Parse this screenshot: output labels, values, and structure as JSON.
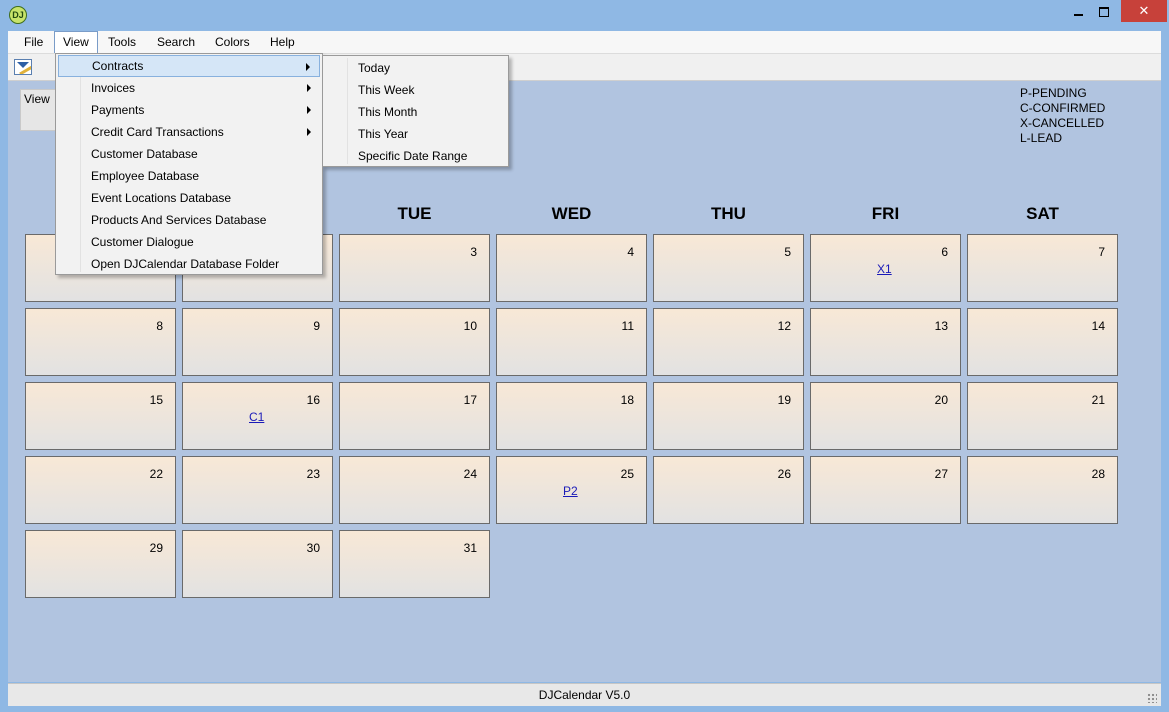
{
  "window": {
    "icon_text": "DJ",
    "close_glyph": "✕"
  },
  "menubar": [
    {
      "label": "File"
    },
    {
      "label": "View"
    },
    {
      "label": "Tools"
    },
    {
      "label": "Search"
    },
    {
      "label": "Colors"
    },
    {
      "label": "Help"
    }
  ],
  "view_panel": {
    "label": "View"
  },
  "legend": [
    "P-PENDING",
    "C-CONFIRMED",
    "X-CANCELLED",
    "L-LEAD"
  ],
  "weekday_headers": [
    "TUE",
    "WED",
    "THU",
    "FRI",
    "SAT"
  ],
  "calendar": {
    "day_cells": [
      {
        "day": ""
      },
      {
        "day": ""
      },
      {
        "day": "3"
      },
      {
        "day": "4"
      },
      {
        "day": "5"
      },
      {
        "day": "6",
        "event": "X1"
      },
      {
        "day": "7"
      },
      {
        "day": "8"
      },
      {
        "day": "9"
      },
      {
        "day": "10"
      },
      {
        "day": "11"
      },
      {
        "day": "12"
      },
      {
        "day": "13"
      },
      {
        "day": "14"
      },
      {
        "day": "15"
      },
      {
        "day": "16",
        "event": "C1"
      },
      {
        "day": "17"
      },
      {
        "day": "18"
      },
      {
        "day": "19"
      },
      {
        "day": "20"
      },
      {
        "day": "21"
      },
      {
        "day": "22"
      },
      {
        "day": "23"
      },
      {
        "day": "24"
      },
      {
        "day": "25",
        "event": "P2"
      },
      {
        "day": "26"
      },
      {
        "day": "27"
      },
      {
        "day": "28"
      },
      {
        "day": "29"
      },
      {
        "day": "30"
      },
      {
        "day": "31"
      }
    ]
  },
  "view_menu": {
    "items": [
      {
        "label": "Contracts",
        "submenu": true
      },
      {
        "label": "Invoices",
        "submenu": true
      },
      {
        "label": "Payments",
        "submenu": true
      },
      {
        "label": "Credit Card Transactions",
        "submenu": true
      },
      {
        "label": "Customer Database"
      },
      {
        "label": "Employee Database"
      },
      {
        "label": "Event Locations Database"
      },
      {
        "label": "Products And Services Database"
      },
      {
        "label": "Customer Dialogue"
      },
      {
        "label": "Open DJCalendar Database Folder"
      }
    ],
    "contracts_submenu": [
      {
        "label": "Today"
      },
      {
        "label": "This Week"
      },
      {
        "label": "This Month"
      },
      {
        "label": "This Year"
      },
      {
        "label": "Specific Date Range"
      }
    ]
  },
  "status_bar": {
    "text": "DJCalendar V5.0"
  },
  "colors": {
    "title_bar": "#8fb8e4",
    "content_bg": "#b1c4e0",
    "close_button": "#c7413a",
    "event_link": "#1a1ab8",
    "menu_highlight": "#d5e6f7"
  }
}
